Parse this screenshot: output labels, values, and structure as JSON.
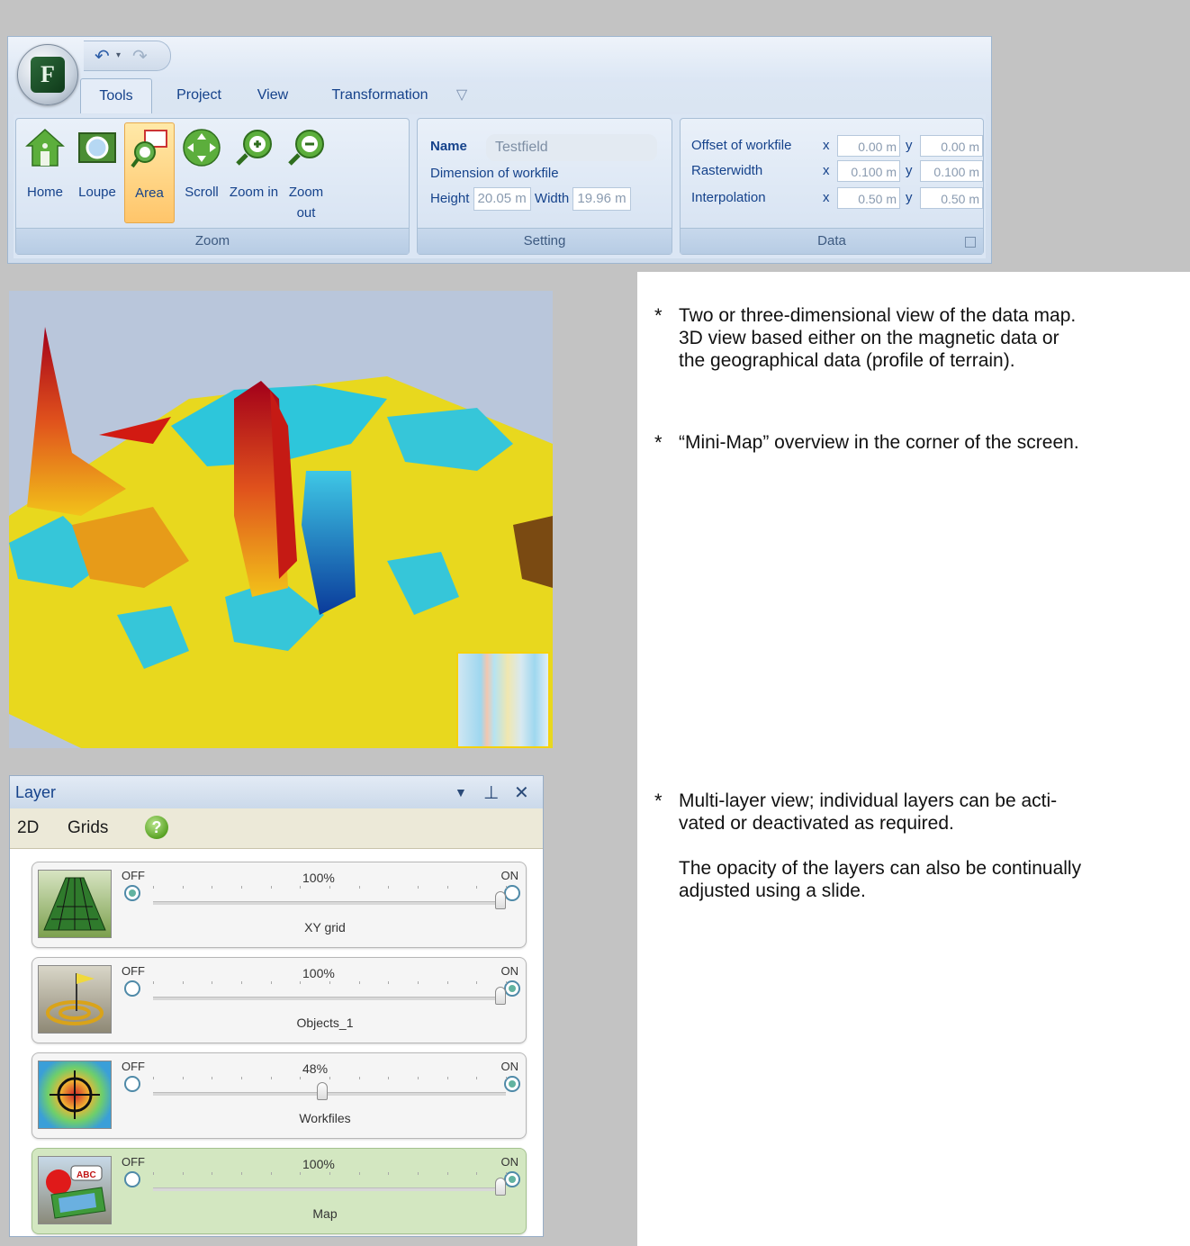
{
  "ribbon": {
    "tabs": [
      "Tools",
      "Project",
      "View",
      "Transformation"
    ],
    "active_tab": "Tools",
    "zoom_group": {
      "label": "Zoom",
      "buttons": [
        {
          "label": "Home",
          "icon": "home-icon"
        },
        {
          "label": "Loupe",
          "icon": "loupe-icon"
        },
        {
          "label": "Area",
          "icon": "area-icon",
          "active": true
        },
        {
          "label": "Scroll",
          "icon": "scroll-icon"
        },
        {
          "label": "Zoom in",
          "icon": "zoom-in-icon"
        },
        {
          "label": "Zoom out",
          "icon": "zoom-out-icon"
        }
      ]
    },
    "setting_group": {
      "label": "Setting",
      "name_label": "Name",
      "name_value": "Testfield",
      "dimension_label": "Dimension of workfile",
      "height_label": "Height",
      "height_value": "20.05 m",
      "width_label": "Width",
      "width_value": "19.96 m"
    },
    "data_group": {
      "label": "Data",
      "offset_label": "Offset of workfile",
      "offset_x": "0.00 m",
      "offset_y": "0.00 m",
      "raster_label": "Rasterwidth",
      "raster_x": "0.100 m",
      "raster_y": "0.100 m",
      "interp_label": "Interpolation",
      "interp_x": "0.50 m",
      "interp_y": "0.50 m",
      "x_label": "x",
      "y_label": "y"
    }
  },
  "layer_panel": {
    "title": "Layer",
    "sub_2d": "2D",
    "sub_grids": "Grids",
    "help": "?",
    "off_label": "OFF",
    "on_label": "ON",
    "layers": [
      {
        "name": "XY grid",
        "percent": "100%",
        "opacity": 1.0,
        "state": "off"
      },
      {
        "name": "Objects_1",
        "percent": "100%",
        "opacity": 1.0,
        "state": "on"
      },
      {
        "name": "Workfiles",
        "percent": "48%",
        "opacity": 0.48,
        "state": "on"
      },
      {
        "name": "Map",
        "percent": "100%",
        "opacity": 1.0,
        "state": "on"
      }
    ]
  },
  "description": {
    "bullet": "*",
    "b1_line1": "Two or three-dimensional view of the data map.",
    "b1_line2": "3D view based either on the magnetic data or",
    "b1_line3": "the geographical data (profile of terrain).",
    "b2_line1": "“Mini-Map” overview in the corner of the screen.",
    "b3_line1": "Multi-layer view; individual layers can be acti-",
    "b3_line2": "vated or deactivated as required.",
    "b3_line3": "The opacity of the layers can also be continually",
    "b3_line4": "adjusted using a slide."
  }
}
